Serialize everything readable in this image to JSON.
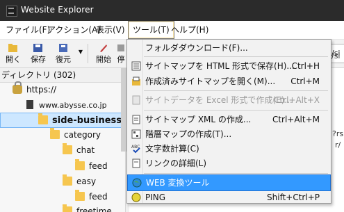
{
  "window": {
    "title": "Website Explorer"
  },
  "menubar": {
    "items": [
      "ファイル(F)",
      "アクション(A)",
      "表示(V)",
      "ツール(T)",
      "ヘルプ(H)"
    ]
  },
  "toolbar": {
    "open_label": "開く",
    "save_label": "保存",
    "restore_label": "復元",
    "start_label": "開始",
    "stop_label": "停",
    "address_fragment": "/si"
  },
  "tree": {
    "header": "ディレクトリ (302)",
    "nodes": [
      {
        "label": "https://",
        "icon": "lock-icon"
      },
      {
        "label": "www.abysse.co.jp",
        "icon": "server-icon"
      },
      {
        "label": "side-business",
        "icon": "folder-icon",
        "selected": true
      },
      {
        "label": "category",
        "icon": "folder-icon"
      },
      {
        "label": "chat",
        "icon": "folder-icon"
      },
      {
        "label": "feed",
        "icon": "folder-icon"
      },
      {
        "label": "easy",
        "icon": "folder-icon"
      },
      {
        "label": "feed",
        "icon": "folder-icon"
      },
      {
        "label": "freetime",
        "icon": "folder-icon"
      }
    ]
  },
  "rightpane": {
    "fragment_1": "/si",
    "fragment_2": "?rs",
    "fragment_3": "r/"
  },
  "tools_menu": {
    "items": [
      {
        "label": "フォルダダウンロード(F)...",
        "shortcut": ""
      },
      {
        "label": "サイトマップを HTML 形式で保存(H)...",
        "shortcut": "Ctrl+H"
      },
      {
        "label": "作成済みサイトマップを開く(M)...",
        "shortcut": "Ctrl+M"
      },
      {
        "label": "サイトデータを Excel 形式で作成(E)...",
        "shortcut": "Ctrl+Alt+X",
        "disabled": true
      },
      {
        "label": "サイトマップ XML の作成...",
        "shortcut": "Ctrl+Alt+M"
      },
      {
        "label": "階層マップの作成(T)...",
        "shortcut": ""
      },
      {
        "label": "文字数計算(C)",
        "shortcut": ""
      },
      {
        "label": "リンクの詳細(L)",
        "shortcut": ""
      },
      {
        "label": "WEB 変換ツール",
        "shortcut": "",
        "highlighted": true
      },
      {
        "label": "PING",
        "shortcut": "Shift+Ctrl+P"
      }
    ]
  },
  "colors": {
    "highlight": "#3399ff",
    "titlebar": "#2b2b2b",
    "folder": "#f6c64f",
    "selection": "#cde7ff"
  }
}
